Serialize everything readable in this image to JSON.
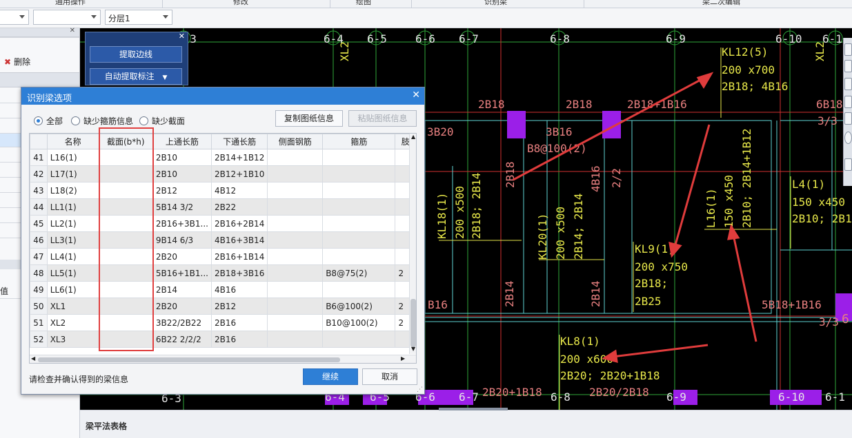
{
  "top_menu": [
    "通用操作",
    "修改",
    "绘图",
    "识别梁",
    "梁二次编辑"
  ],
  "toolbar": {
    "combo3_value": "分层1"
  },
  "left_panel": {
    "delete_label": "删除",
    "partial_label": "值"
  },
  "palette": {
    "btn1": "提取边线",
    "btn2": "自动提取标注"
  },
  "cad": {
    "axis_labels": [
      "6-3",
      "6-4",
      "6-5",
      "6-6",
      "6-7",
      "6-8",
      "6-9",
      "6-10",
      "6-1"
    ],
    "bottom_axis_labels": [
      "6-3",
      "6-4",
      "6-5",
      "6-6",
      "6-7",
      "6-8",
      "6-9",
      "6-10",
      "6-1"
    ],
    "text_xl2": "XL2",
    "kl12": [
      "KL12(5)",
      "200 x700",
      "2B18; 4B16"
    ],
    "rebar_top": [
      "2B18",
      "2B18",
      "2B18+1B16",
      "6B18",
      "3/3"
    ],
    "b20": "3B20",
    "b16": "3B16",
    "b8": "B8@100(2)",
    "v_2b18": "2B18",
    "v_4b16": "4B16",
    "v_2_2": "2/2",
    "kl18": [
      "KL18(1)",
      "200 x500",
      "2B18; 2B14"
    ],
    "kl20": [
      "KL20(1)",
      "200 x500",
      "2B14; 2B14"
    ],
    "kl9": [
      "KL9(1)",
      "200 x750",
      "2B18;",
      "2B25"
    ],
    "l16": [
      "L16(1)",
      "150 x450",
      "2B10; 2B14+1B12"
    ],
    "l4": [
      "L4(1)",
      "150 x450",
      "2B10; 2B10"
    ],
    "b2b14_1": "2B14",
    "b2b14_2": "2B14",
    "b16_left": "B16",
    "b5b18": "5B18+1B16",
    "b33": "3/3",
    "kl8": [
      "KL8(1)",
      "200 x600",
      "2B20; 2B20+1B18"
    ],
    "bottom_rebar": [
      "2B20+1B18",
      "2B20/2B18"
    ],
    "right6": "6"
  },
  "dialog": {
    "title": "识别梁选项",
    "radios": [
      "全部",
      "缺少箍筋信息",
      "缺少截面"
    ],
    "copy_btn": "复制图纸信息",
    "paste_btn": "粘贴图纸信息",
    "columns": [
      "名称",
      "截面(b*h)",
      "上通长筋",
      "下通长筋",
      "侧面钢筋",
      "箍筋",
      "肢"
    ],
    "rows": [
      {
        "n": "41",
        "name": "L16(1)",
        "sec": "",
        "top": "2B10",
        "bot": "2B14+1B12",
        "side": "",
        "stir": "",
        "leg": ""
      },
      {
        "n": "42",
        "name": "L17(1)",
        "sec": "",
        "top": "2B10",
        "bot": "2B12+1B10",
        "side": "",
        "stir": "",
        "leg": ""
      },
      {
        "n": "43",
        "name": "L18(2)",
        "sec": "",
        "top": "2B12",
        "bot": "4B12",
        "side": "",
        "stir": "",
        "leg": ""
      },
      {
        "n": "44",
        "name": "LL1(1)",
        "sec": "",
        "top": "5B14 3/2",
        "bot": "2B22",
        "side": "",
        "stir": "",
        "leg": ""
      },
      {
        "n": "45",
        "name": "LL2(1)",
        "sec": "",
        "top": "2B16+3B1...",
        "bot": "2B16+2B14",
        "side": "",
        "stir": "",
        "leg": ""
      },
      {
        "n": "46",
        "name": "LL3(1)",
        "sec": "",
        "top": "9B14 6/3",
        "bot": "4B16+3B14",
        "side": "",
        "stir": "",
        "leg": ""
      },
      {
        "n": "47",
        "name": "LL4(1)",
        "sec": "",
        "top": "2B20",
        "bot": "2B16+1B14",
        "side": "",
        "stir": "",
        "leg": ""
      },
      {
        "n": "48",
        "name": "LL5(1)",
        "sec": "",
        "top": "5B16+1B1...",
        "bot": "2B18+3B16",
        "side": "",
        "stir": "B8@75(2)",
        "leg": "2"
      },
      {
        "n": "49",
        "name": "LL6(1)",
        "sec": "",
        "top": "2B14",
        "bot": "4B16",
        "side": "",
        "stir": "",
        "leg": ""
      },
      {
        "n": "50",
        "name": "XL1",
        "sec": "",
        "top": "2B20",
        "bot": "2B12",
        "side": "",
        "stir": "B6@100(2)",
        "leg": "2"
      },
      {
        "n": "51",
        "name": "XL2",
        "sec": "",
        "top": "3B22/2B22",
        "bot": "2B16",
        "side": "",
        "stir": "B10@100(2)",
        "leg": "2"
      },
      {
        "n": "52",
        "name": "XL3",
        "sec": "",
        "top": "6B22 2/2/2",
        "bot": "2B16",
        "side": "",
        "stir": "",
        "leg": ""
      }
    ],
    "status": "请检查并确认得到的梁信息",
    "continue_btn": "继续",
    "cancel_btn": "取消"
  },
  "bottom_panel": {
    "title": "梁平法表格"
  },
  "colors": {
    "accent": "#2e7fd6",
    "cad_yellow": "#e8e84a",
    "cad_pink": "#e88080",
    "cad_cyan": "#5fd3d3",
    "cad_magenta": "#9b1fe8",
    "annot_red": "#e03c3c"
  }
}
